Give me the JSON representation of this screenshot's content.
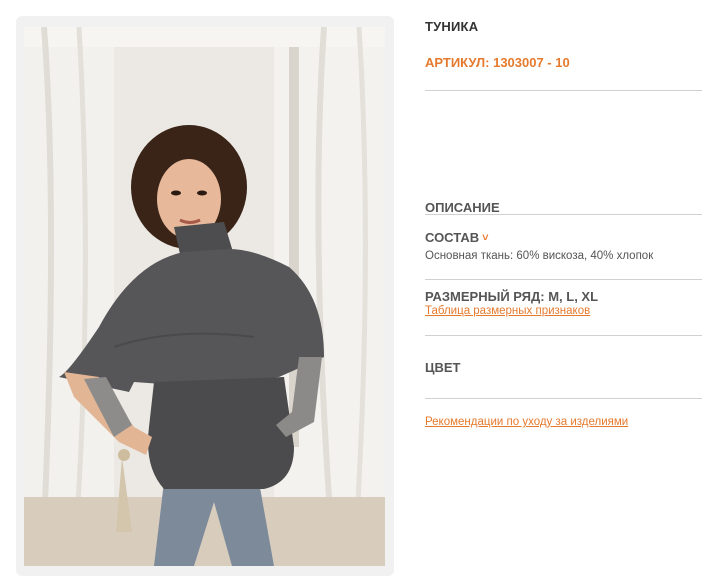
{
  "product": {
    "title": "ТУНИКА",
    "article": "АРТИКУЛ: 1303007 - 10",
    "description_heading": "ОПИСАНИЕ",
    "composition_heading": "СОСТАВ",
    "composition_text": "Основная ткань: 60% вискоза, 40% хлопок",
    "size_range": "РАЗМЕРНЫЙ РЯД: M, L, XL",
    "size_table_link": "Таблица размерных признаков",
    "color_heading": "ЦВЕТ",
    "care_link": "Рекомендации по уходу за изделиями"
  },
  "colors": {
    "accent": "#e57a2e",
    "text": "#555555",
    "rule": "#d0d0d0"
  },
  "icons": {
    "composition_toggle": "chevron-down-icon"
  }
}
